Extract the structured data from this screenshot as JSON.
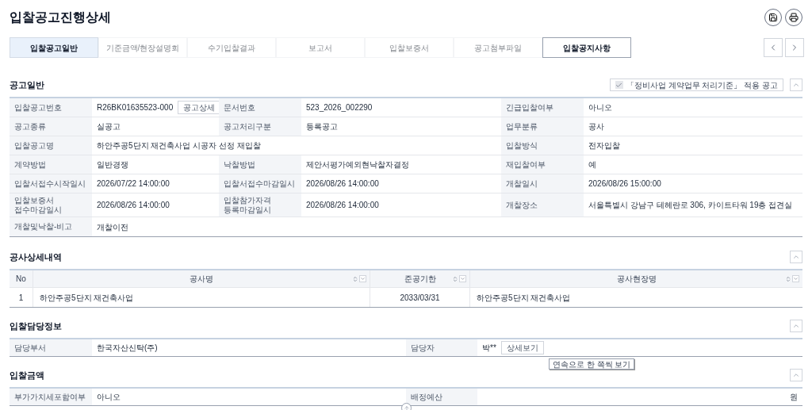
{
  "page": {
    "title": "입찰공고진행상세"
  },
  "tabs": [
    {
      "label": "입찰공고일반",
      "selected": true,
      "disabled": false
    },
    {
      "label": "기준금액/현장설명회",
      "selected": false,
      "disabled": true
    },
    {
      "label": "수기입찰결과",
      "selected": false,
      "disabled": true
    },
    {
      "label": "보고서",
      "selected": false,
      "disabled": true
    },
    {
      "label": "입찰보증서",
      "selected": false,
      "disabled": true
    },
    {
      "label": "공고첨부파일",
      "selected": false,
      "disabled": true
    },
    {
      "label": "입찰공지사항",
      "selected": false,
      "disabled": false
    }
  ],
  "general": {
    "title": "공고일반",
    "notice": {
      "label": "「정비사업 계약업무 처리기준」 적용 공고",
      "checked": true
    },
    "rows": [
      [
        {
          "label": "입찰공고번호",
          "value": "R26BK01635523-000",
          "action": "공고상세"
        },
        {
          "label": "문서번호",
          "value": "523_2026_002290"
        },
        {
          "label": "긴급입찰여부",
          "value": "아니오"
        }
      ],
      [
        {
          "label": "공고종류",
          "value": "실공고"
        },
        {
          "label": "공고처리구분",
          "value": "등록공고"
        },
        {
          "label": "업무분류",
          "value": "공사"
        }
      ],
      [
        {
          "label": "입찰공고명",
          "value": "하안주공5단지 재건축사업 시공자 선정 재입찰"
        },
        null,
        {
          "label": "입찰방식",
          "value": "전자입찰"
        }
      ],
      [
        {
          "label": "계약방법",
          "value": "일반경쟁"
        },
        {
          "label": "낙찰방법",
          "value": "제안서평가예외현낙찰자결정"
        },
        {
          "label": "재입찰여부",
          "value": "예"
        }
      ],
      [
        {
          "label": "입찰서접수시작일시",
          "value": "2026/07/22 14:00:00"
        },
        {
          "label": "입찰서접수마감일시",
          "value": "2026/08/26 14:00:00"
        },
        {
          "label": "개찰일시",
          "value": "2026/08/26 15:00:00"
        }
      ],
      [
        {
          "label": "입찰보증서\n접수마감일시",
          "value": "2026/08/26 14:00:00"
        },
        {
          "label": "입찰참가자격\n등록마감일시",
          "value": "2026/08/26 14:00:00"
        },
        {
          "label": "개찰장소",
          "value": "서울특별시 강남구 테헤란로 306, 카이트타워 19층 접견실"
        }
      ],
      [
        {
          "label": "개찰및낙찰-비고",
          "value": "개찰이전"
        },
        null,
        null
      ]
    ]
  },
  "details": {
    "title": "공사상세내역",
    "columns": [
      {
        "label": "No",
        "sortable": false
      },
      {
        "label": "공사명",
        "sortable": true
      },
      {
        "label": "준공기한",
        "sortable": true
      },
      {
        "label": "공사현장명",
        "sortable": true
      }
    ],
    "rows": [
      [
        "1",
        "하안주공5단지 재건축사업",
        "2033/03/31",
        "하안주공5단지 재건축사업"
      ]
    ]
  },
  "staff": {
    "title": "입찰담당정보",
    "fields": [
      {
        "label": "담당부서",
        "value": "한국자산신탁(주)"
      },
      {
        "label": "담당자",
        "value": "박**",
        "action": "상세보기"
      }
    ]
  },
  "budget": {
    "title": "입찰금액",
    "fields": [
      {
        "label": "부가가치세포함여부",
        "value": "아니오"
      },
      {
        "label": "배정예산",
        "unit": "원"
      }
    ]
  },
  "tooltip": {
    "text": "연속으로 한 쪽씩 보기"
  }
}
